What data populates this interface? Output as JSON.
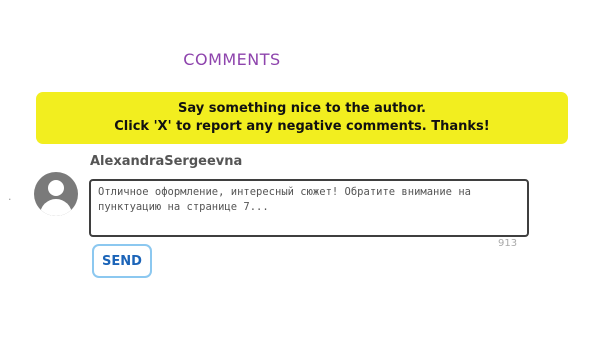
{
  "comments": {
    "title": "COMMENTS"
  },
  "notice": {
    "line1": "Say something nice to the author.",
    "line2": "Click 'X' to report any negative comments. Thanks!",
    "background_color": "#f2ee1f"
  },
  "side_mark": ".",
  "composer": {
    "avatar_icon": "user-avatar-icon",
    "username": "AlexandraSergeevna",
    "comment_text": "Отличное оформление, интересный сюжет! Обратите внимание на пунктуацию на странице 7...",
    "char_count": "913",
    "send_label": "SEND"
  },
  "colors": {
    "title": "#8e44ad",
    "send_text": "#1b64b8",
    "send_border": "#8cc8f0"
  }
}
